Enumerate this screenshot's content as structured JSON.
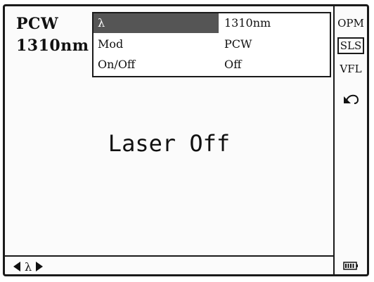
{
  "status": {
    "mode": "PCW",
    "wavelength": "1310nm"
  },
  "menu": {
    "rows": [
      {
        "label": "λ",
        "value": "1310nm"
      },
      {
        "label": "Mod",
        "value": "PCW"
      },
      {
        "label": "On/Off",
        "value": "Off"
      }
    ]
  },
  "main": {
    "message": "Laser Off"
  },
  "sidebar": {
    "items": [
      {
        "label": "OPM"
      },
      {
        "label": "SLS"
      },
      {
        "label": "VFL"
      }
    ],
    "back_icon": "back-arrow-icon",
    "battery_icon": "battery-icon"
  },
  "statusbar": {
    "param_label": "λ"
  },
  "colors": {
    "selection": "#555555",
    "border": "#1a1a1a"
  }
}
